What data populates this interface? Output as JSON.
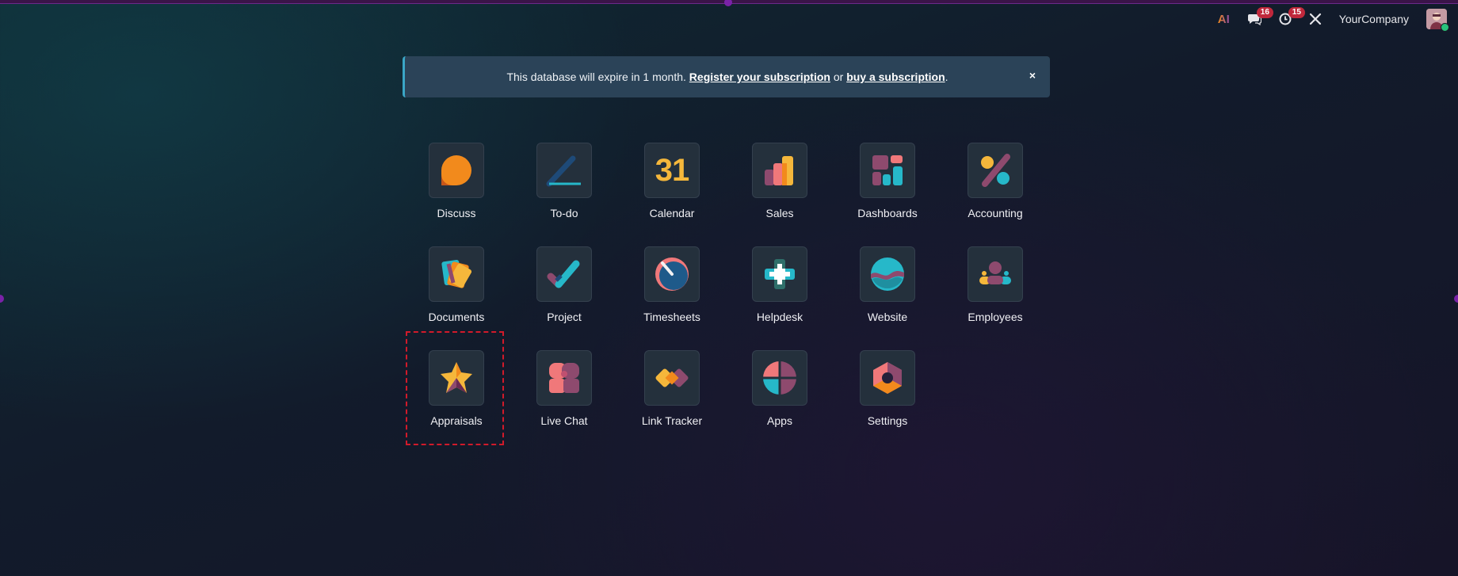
{
  "systray": {
    "ai_label": "AI",
    "messages_count": "16",
    "activities_count": "15",
    "company": "YourCompany"
  },
  "banner": {
    "text_before": "This database will expire in 1 month.",
    "register_link": "Register your subscription",
    "text_middle": "or",
    "buy_link": "buy a subscription",
    "text_after": ".",
    "close": "×"
  },
  "apps": [
    {
      "label": "Discuss",
      "icon": "discuss-icon"
    },
    {
      "label": "To-do",
      "icon": "todo-icon"
    },
    {
      "label": "Calendar",
      "icon": "calendar-icon",
      "icon_text": "31"
    },
    {
      "label": "Sales",
      "icon": "sales-icon"
    },
    {
      "label": "Dashboards",
      "icon": "dashboards-icon"
    },
    {
      "label": "Accounting",
      "icon": "accounting-icon"
    },
    {
      "label": "Documents",
      "icon": "documents-icon"
    },
    {
      "label": "Project",
      "icon": "project-icon"
    },
    {
      "label": "Timesheets",
      "icon": "timesheets-icon"
    },
    {
      "label": "Helpdesk",
      "icon": "helpdesk-icon"
    },
    {
      "label": "Website",
      "icon": "website-icon"
    },
    {
      "label": "Employees",
      "icon": "employees-icon"
    },
    {
      "label": "Appraisals",
      "icon": "appraisals-icon"
    },
    {
      "label": "Live Chat",
      "icon": "live-chat-icon"
    },
    {
      "label": "Link Tracker",
      "icon": "link-tracker-icon"
    },
    {
      "label": "Apps",
      "icon": "apps-icon"
    },
    {
      "label": "Settings",
      "icon": "settings-icon"
    }
  ],
  "colors": {
    "orange": "#f28a1c",
    "teal": "#26b8c9",
    "plum": "#8e4a6e",
    "yellow": "#f5b73b",
    "coral": "#f0787a",
    "highlight": "#d11a2a"
  }
}
